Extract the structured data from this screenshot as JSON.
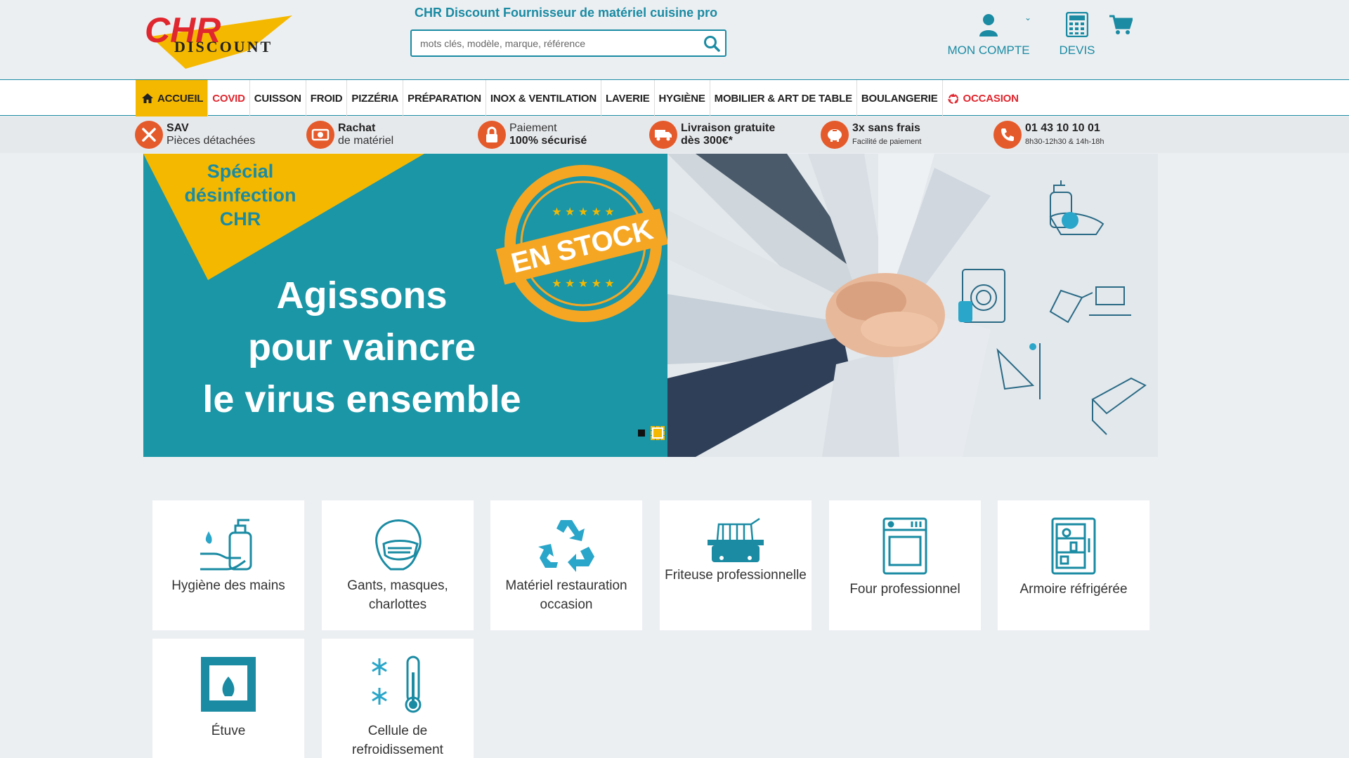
{
  "header": {
    "logo_top": "CHR",
    "logo_bottom": "DISCOUNT",
    "tagline": "CHR Discount Fournisseur de matériel cuisine pro",
    "search_placeholder": "mots clés, modèle, marque, référence",
    "account_label": "MON COMPTE",
    "quote_label": "DEVIS"
  },
  "nav": {
    "items": [
      "ACCUEIL",
      "COVID",
      "CUISSON",
      "FROID",
      "PIZZÉRIA",
      "PRÉPARATION",
      "INOX & VENTILATION",
      "LAVERIE",
      "HYGIÈNE",
      "MOBILIER & ART DE TABLE",
      "BOULANGERIE",
      "OCCASION"
    ]
  },
  "benefits": [
    {
      "title": "SAV",
      "subtitle": "Pièces détachées",
      "icon": "tools-icon"
    },
    {
      "title": "Rachat",
      "subtitle": "de matériel",
      "icon": "money-icon"
    },
    {
      "title": "Paiement",
      "subtitle": "100% sécurisé",
      "icon": "lock-icon"
    },
    {
      "title": "Livraison gratuite",
      "subtitle": "dès 300€*",
      "icon": "truck-icon"
    },
    {
      "title": "3x sans frais",
      "subtitle": "Facilité de paiement",
      "icon": "piggy-bank-icon"
    },
    {
      "title": "01 43 10 10 01",
      "subtitle": "8h30-12h30 & 14h-18h",
      "icon": "phone-icon"
    }
  ],
  "banner": {
    "special_line1": "Spécial",
    "special_line2": "désinfection",
    "special_line3": "CHR",
    "headline_line1": "Agissons",
    "headline_line2": "pour vaincre",
    "headline_line3": "le virus ensemble",
    "badge": "EN STOCK"
  },
  "categories": [
    {
      "label": "Hygiène des mains",
      "icon": "hand-sanitizer-icon"
    },
    {
      "label": "Gants, masques, charlottes",
      "icon": "mask-icon"
    },
    {
      "label": "Matériel restauration occasion",
      "icon": "recycle-icon"
    },
    {
      "label": "Friteuse professionnelle",
      "icon": "fryer-icon"
    },
    {
      "label": "Four professionnel",
      "icon": "oven-icon"
    },
    {
      "label": "Armoire réfrigérée",
      "icon": "fridge-icon"
    },
    {
      "label": "Étuve",
      "icon": "warming-cabinet-icon"
    },
    {
      "label": "Cellule de refroidissement",
      "icon": "blast-chiller-icon"
    }
  ],
  "colors": {
    "teal": "#1a8ba3",
    "yellow": "#f5b800",
    "red": "#e0262e",
    "orange": "#e55a2b"
  }
}
